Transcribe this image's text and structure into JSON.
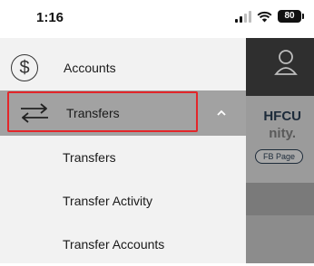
{
  "status_bar": {
    "time": "1:16",
    "battery": "80"
  },
  "background": {
    "title": "HFCU",
    "subtitle": "nity.",
    "fb_button": "FB Page"
  },
  "menu": {
    "accounts_label": "Accounts",
    "transfers_label": "Transfers",
    "sub_items": [
      "Transfers",
      "Transfer Activity",
      "Transfer Accounts"
    ]
  },
  "colors": {
    "highlight": "#e3262a",
    "selected_row": "#a2a2a2",
    "drawer_bg": "#f2f2f2"
  }
}
